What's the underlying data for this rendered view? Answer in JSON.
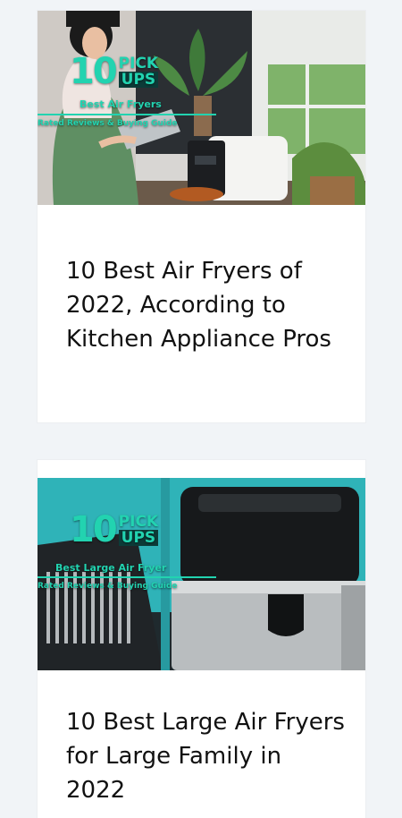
{
  "articles": [
    {
      "title": "10 Best Air Fryers of 2022, According to Kitchen Appliance Pros",
      "thumbnail": {
        "logo_number": "10",
        "logo_word_top": "PICK",
        "logo_word_bottom": "UPS",
        "tagline": "Best Air Fryers",
        "subtagline": "Rated Reviews & Buying Guide"
      }
    },
    {
      "title": "10 Best Large Air Fryers for Large Family in 2022",
      "thumbnail": {
        "logo_number": "10",
        "logo_word_top": "PICK",
        "logo_word_bottom": "UPS",
        "tagline": "Best Large Air Fryer",
        "subtagline": "Rated Reviews & Buying Guide"
      }
    }
  ],
  "colors": {
    "page_background": "#f1f4f7",
    "card_background": "#ffffff",
    "brand_accent": "#22d3b0",
    "title_text": "#111111"
  }
}
